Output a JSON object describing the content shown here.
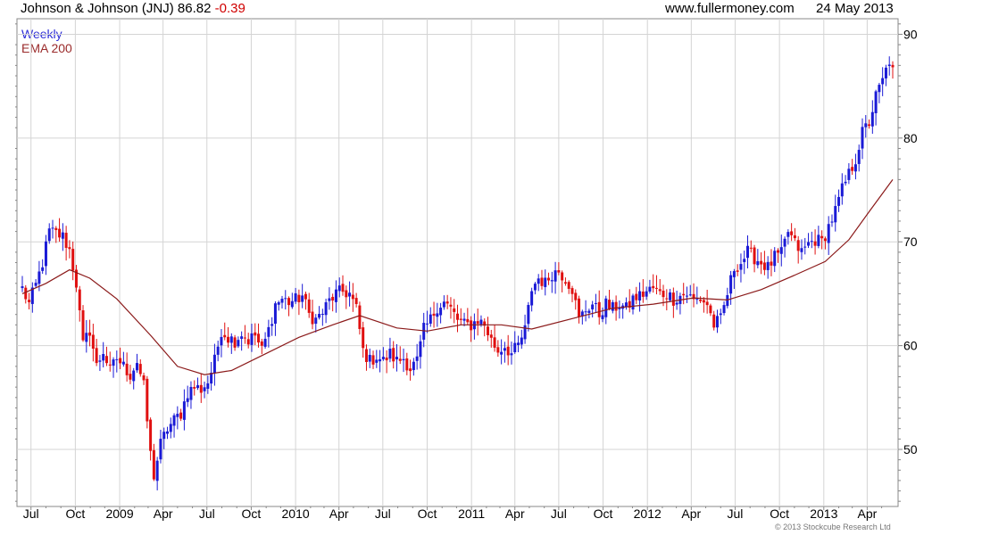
{
  "header": {
    "symbol": "Johnson & Johnson (JNJ) 86.82",
    "change": "-0.39",
    "website": "www.fullermoney.com",
    "date": "24 May 2013"
  },
  "legend": {
    "weekly": "Weekly",
    "ema": "EMA 200"
  },
  "copyright": "© 2013 Stockcube Research Ltd",
  "colors": {
    "up": "#1a1ad6",
    "down": "#e01010",
    "ema": "#8b1a1a",
    "grid": "#d4d4d4",
    "axis": "#888888"
  },
  "chart_data": {
    "type": "candlestick",
    "interval": "weekly",
    "x_range": [
      "2008-06-13",
      "2013-05-24"
    ],
    "ylim": [
      44.5,
      91.5
    ],
    "y_ticks": [
      50,
      60,
      70,
      80,
      90
    ],
    "x_ticks": [
      {
        "label": "Jul",
        "date": "2008-07-01"
      },
      {
        "label": "Oct",
        "date": "2008-10-01"
      },
      {
        "label": "2009",
        "date": "2009-01-01"
      },
      {
        "label": "Apr",
        "date": "2009-04-01"
      },
      {
        "label": "Jul",
        "date": "2009-07-01"
      },
      {
        "label": "Oct",
        "date": "2009-10-01"
      },
      {
        "label": "2010",
        "date": "2010-01-01"
      },
      {
        "label": "Apr",
        "date": "2010-04-01"
      },
      {
        "label": "Jul",
        "date": "2010-07-01"
      },
      {
        "label": "Oct",
        "date": "2010-10-01"
      },
      {
        "label": "2011",
        "date": "2011-01-01"
      },
      {
        "label": "Apr",
        "date": "2011-04-01"
      },
      {
        "label": "Jul",
        "date": "2011-07-01"
      },
      {
        "label": "Oct",
        "date": "2011-10-01"
      },
      {
        "label": "2012",
        "date": "2012-01-01"
      },
      {
        "label": "Apr",
        "date": "2012-04-01"
      },
      {
        "label": "Jul",
        "date": "2012-07-01"
      },
      {
        "label": "Oct",
        "date": "2012-10-01"
      },
      {
        "label": "2013",
        "date": "2013-01-01"
      },
      {
        "label": "Apr",
        "date": "2013-04-01"
      }
    ],
    "close_path": [
      [
        "2008-06-13",
        65.5
      ],
      [
        "2008-06-27",
        64.0
      ],
      [
        "2008-07-11",
        65.8
      ],
      [
        "2008-07-25",
        68.0
      ],
      [
        "2008-08-08",
        71.0
      ],
      [
        "2008-08-22",
        70.8
      ],
      [
        "2008-09-05",
        70.5
      ],
      [
        "2008-09-19",
        69.2
      ],
      [
        "2008-10-03",
        66.0
      ],
      [
        "2008-10-17",
        60.0
      ],
      [
        "2008-10-31",
        61.5
      ],
      [
        "2008-11-14",
        58.0
      ],
      [
        "2008-11-28",
        59.5
      ],
      [
        "2008-12-12",
        57.5
      ],
      [
        "2008-12-26",
        58.8
      ],
      [
        "2009-01-09",
        58.0
      ],
      [
        "2009-01-23",
        57.2
      ],
      [
        "2009-02-06",
        58.5
      ],
      [
        "2009-02-20",
        56.0
      ],
      [
        "2009-03-06",
        49.5
      ],
      [
        "2009-03-13",
        47.5
      ],
      [
        "2009-03-27",
        50.5
      ],
      [
        "2009-04-10",
        52.0
      ],
      [
        "2009-04-24",
        52.8
      ],
      [
        "2009-05-08",
        53.5
      ],
      [
        "2009-05-22",
        55.5
      ],
      [
        "2009-06-05",
        56.0
      ],
      [
        "2009-06-19",
        55.8
      ],
      [
        "2009-07-03",
        56.5
      ],
      [
        "2009-07-17",
        58.5
      ],
      [
        "2009-07-31",
        61.5
      ],
      [
        "2009-08-14",
        60.8
      ],
      [
        "2009-08-28",
        60.5
      ],
      [
        "2009-09-11",
        61.2
      ],
      [
        "2009-09-25",
        60.5
      ],
      [
        "2009-10-09",
        61.0
      ],
      [
        "2009-10-23",
        59.5
      ],
      [
        "2009-11-06",
        61.5
      ],
      [
        "2009-11-20",
        64.0
      ],
      [
        "2009-12-04",
        64.5
      ],
      [
        "2009-12-18",
        64.2
      ],
      [
        "2010-01-01",
        64.4
      ],
      [
        "2010-01-15",
        64.8
      ],
      [
        "2010-01-29",
        63.0
      ],
      [
        "2010-02-12",
        62.5
      ],
      [
        "2010-02-26",
        63.2
      ],
      [
        "2010-03-12",
        64.3
      ],
      [
        "2010-03-26",
        65.0
      ],
      [
        "2010-04-09",
        65.2
      ],
      [
        "2010-04-23",
        65.0
      ],
      [
        "2010-05-07",
        63.5
      ],
      [
        "2010-05-21",
        59.5
      ],
      [
        "2010-06-04",
        58.5
      ],
      [
        "2010-06-18",
        59.0
      ],
      [
        "2010-07-02",
        58.5
      ],
      [
        "2010-07-16",
        59.2
      ],
      [
        "2010-07-30",
        58.5
      ],
      [
        "2010-08-13",
        58.8
      ],
      [
        "2010-08-27",
        57.8
      ],
      [
        "2010-09-10",
        58.5
      ],
      [
        "2010-09-24",
        61.5
      ],
      [
        "2010-10-08",
        62.5
      ],
      [
        "2010-10-22",
        63.8
      ],
      [
        "2010-11-05",
        64.2
      ],
      [
        "2010-11-19",
        63.5
      ],
      [
        "2010-12-03",
        62.5
      ],
      [
        "2010-12-17",
        62.0
      ],
      [
        "2010-12-31",
        62.0
      ],
      [
        "2011-01-14",
        62.5
      ],
      [
        "2011-01-28",
        62.0
      ],
      [
        "2011-02-11",
        60.5
      ],
      [
        "2011-02-25",
        59.5
      ],
      [
        "2011-03-11",
        60.0
      ],
      [
        "2011-03-25",
        59.2
      ],
      [
        "2011-04-08",
        60.0
      ],
      [
        "2011-04-22",
        61.5
      ],
      [
        "2011-05-06",
        65.5
      ],
      [
        "2011-05-20",
        66.5
      ],
      [
        "2011-06-03",
        66.0
      ],
      [
        "2011-06-17",
        67.0
      ],
      [
        "2011-07-01",
        67.2
      ],
      [
        "2011-07-15",
        66.5
      ],
      [
        "2011-07-29",
        65.5
      ],
      [
        "2011-08-12",
        62.5
      ],
      [
        "2011-08-26",
        63.5
      ],
      [
        "2011-09-09",
        64.0
      ],
      [
        "2011-09-23",
        63.0
      ],
      [
        "2011-10-07",
        64.0
      ],
      [
        "2011-10-21",
        63.5
      ],
      [
        "2011-11-04",
        64.0
      ],
      [
        "2011-11-18",
        63.5
      ],
      [
        "2011-12-02",
        64.5
      ],
      [
        "2011-12-16",
        64.8
      ],
      [
        "2011-12-30",
        65.2
      ],
      [
        "2012-01-13",
        65.5
      ],
      [
        "2012-01-27",
        65.0
      ],
      [
        "2012-02-10",
        65.0
      ],
      [
        "2012-02-24",
        64.5
      ],
      [
        "2012-03-09",
        64.8
      ],
      [
        "2012-03-23",
        65.0
      ],
      [
        "2012-04-06",
        64.3
      ],
      [
        "2012-04-20",
        64.5
      ],
      [
        "2012-05-04",
        64.0
      ],
      [
        "2012-05-18",
        62.0
      ],
      [
        "2012-06-01",
        62.5
      ],
      [
        "2012-06-15",
        65.0
      ],
      [
        "2012-06-29",
        67.5
      ],
      [
        "2012-07-13",
        68.0
      ],
      [
        "2012-07-27",
        69.0
      ],
      [
        "2012-08-10",
        68.5
      ],
      [
        "2012-08-24",
        68.0
      ],
      [
        "2012-09-07",
        67.5
      ],
      [
        "2012-09-21",
        68.5
      ],
      [
        "2012-10-05",
        68.8
      ],
      [
        "2012-10-19",
        71.0
      ],
      [
        "2012-11-02",
        69.8
      ],
      [
        "2012-11-16",
        69.0
      ],
      [
        "2012-11-30",
        69.8
      ],
      [
        "2012-12-14",
        70.2
      ],
      [
        "2012-12-28",
        70.0
      ],
      [
        "2013-01-11",
        71.5
      ],
      [
        "2013-01-25",
        73.0
      ],
      [
        "2013-02-08",
        75.0
      ],
      [
        "2013-02-22",
        76.5
      ],
      [
        "2013-03-08",
        78.0
      ],
      [
        "2013-03-22",
        80.5
      ],
      [
        "2013-04-05",
        81.5
      ],
      [
        "2013-04-19",
        84.0
      ],
      [
        "2013-05-03",
        85.5
      ],
      [
        "2013-05-17",
        87.5
      ],
      [
        "2013-05-24",
        86.82
      ]
    ],
    "ema_200": [
      [
        "2008-06-13",
        65.0
      ],
      [
        "2008-08-01",
        66.0
      ],
      [
        "2008-09-19",
        67.3
      ],
      [
        "2008-10-31",
        66.5
      ],
      [
        "2008-12-26",
        64.5
      ],
      [
        "2009-03-06",
        61.0
      ],
      [
        "2009-05-01",
        58.0
      ],
      [
        "2009-06-26",
        57.2
      ],
      [
        "2009-08-21",
        57.6
      ],
      [
        "2009-10-30",
        59.2
      ],
      [
        "2010-01-08",
        60.8
      ],
      [
        "2010-03-19",
        62.0
      ],
      [
        "2010-05-14",
        62.9
      ],
      [
        "2010-07-30",
        61.7
      ],
      [
        "2010-10-01",
        61.4
      ],
      [
        "2010-12-10",
        62.0
      ],
      [
        "2011-03-04",
        62.0
      ],
      [
        "2011-05-06",
        61.6
      ],
      [
        "2011-07-29",
        62.6
      ],
      [
        "2011-10-21",
        63.6
      ],
      [
        "2012-01-13",
        64.0
      ],
      [
        "2012-04-06",
        64.6
      ],
      [
        "2012-06-15",
        64.4
      ],
      [
        "2012-08-24",
        65.4
      ],
      [
        "2012-11-02",
        66.8
      ],
      [
        "2013-01-04",
        68.1
      ],
      [
        "2013-02-22",
        70.2
      ],
      [
        "2013-04-05",
        72.9
      ],
      [
        "2013-05-24",
        76.0
      ]
    ]
  }
}
